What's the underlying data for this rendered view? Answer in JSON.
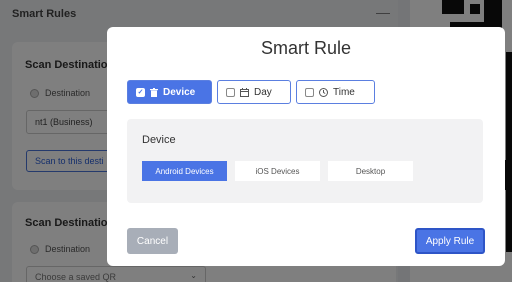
{
  "background": {
    "panel_title": "Smart Rules",
    "collapse_icon": "minus-icon",
    "card1": {
      "title": "Scan Destination",
      "radio_label": "Destination",
      "input_value": "nt1 (Business)",
      "scan_button": "Scan to this desti"
    },
    "card2": {
      "title": "Scan Destination",
      "radio_label": "Destination",
      "select_placeholder": "Choose a saved QR"
    }
  },
  "modal": {
    "title": "Smart Rule",
    "tabs": [
      {
        "label": "Device",
        "icon": "trash-icon",
        "checked": true
      },
      {
        "label": "Day",
        "icon": "calendar-icon",
        "checked": false
      },
      {
        "label": "Time",
        "icon": "clock-icon",
        "checked": false
      }
    ],
    "panel": {
      "label": "Device",
      "options": [
        {
          "label": "Android Devices",
          "selected": true
        },
        {
          "label": "iOS Devices",
          "selected": false
        },
        {
          "label": "Desktop",
          "selected": false
        }
      ]
    },
    "cancel_label": "Cancel",
    "apply_label": "Apply Rule"
  },
  "colors": {
    "accent": "#4a74e5",
    "cancel": "#a8aeb8",
    "overlay": "rgba(0,0,0,0.5)"
  }
}
